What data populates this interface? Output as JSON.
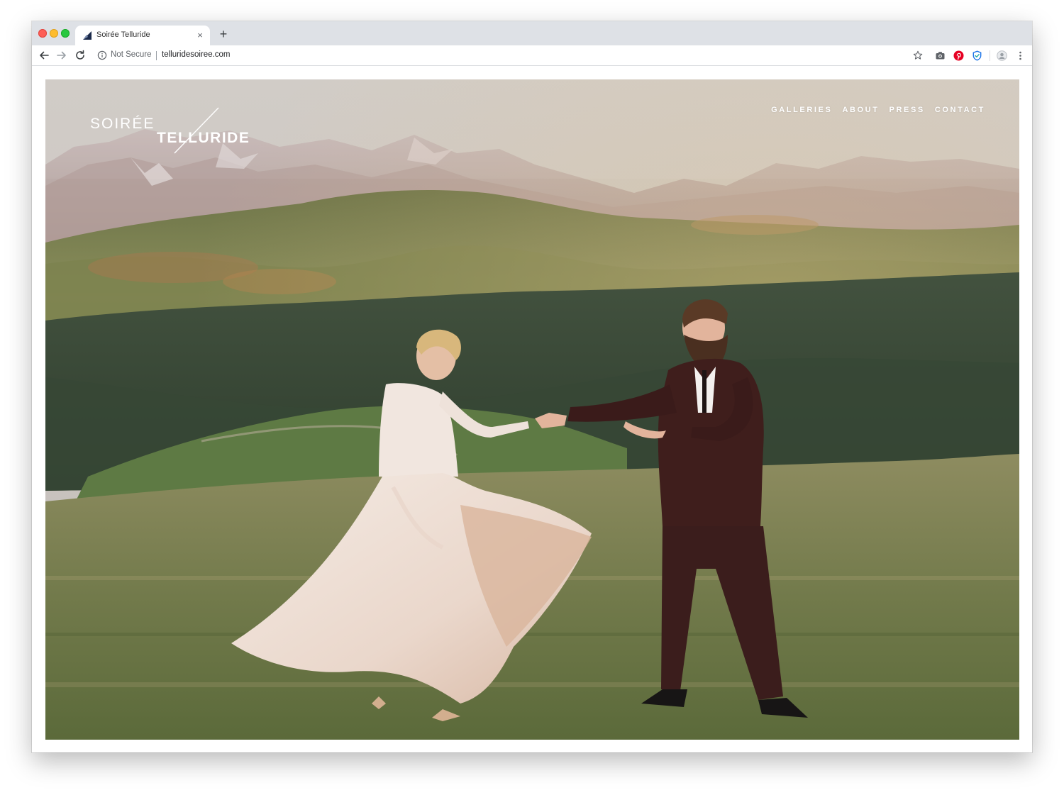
{
  "browser": {
    "tab": {
      "title": "Soirée Telluride",
      "close_glyph": "×"
    },
    "new_tab_glyph": "+",
    "address_bar": {
      "security_label": "Not Secure",
      "url": "telluridesoiree.com"
    },
    "icons": {
      "back": "arrow-left-icon",
      "forward": "arrow-right-icon",
      "reload": "reload-icon",
      "info": "info-icon",
      "bookmark": "star-icon",
      "extensions": [
        "camera-icon",
        "pinterest-icon",
        "shield-icon"
      ],
      "profile": "avatar-icon",
      "menu": "kebab-menu-icon"
    },
    "colors": {
      "tabstrip": "#dee1e6",
      "pinterest": "#e60023",
      "shield": "#1a73e8"
    }
  },
  "site": {
    "logo": {
      "line1": "SOIRÉE",
      "line2": "TELLURIDE"
    },
    "nav": [
      {
        "label": "GALLERIES"
      },
      {
        "label": "ABOUT"
      },
      {
        "label": "PRESS"
      },
      {
        "label": "CONTACT"
      }
    ],
    "hero": {
      "palette": {
        "sky": "#c9c4bd",
        "mountains": "#b8a9a6",
        "forest": "#3f4e3a",
        "meadow": "#7f8458",
        "dress": "#efe0d6",
        "suit": "#3d1d1b"
      }
    }
  }
}
